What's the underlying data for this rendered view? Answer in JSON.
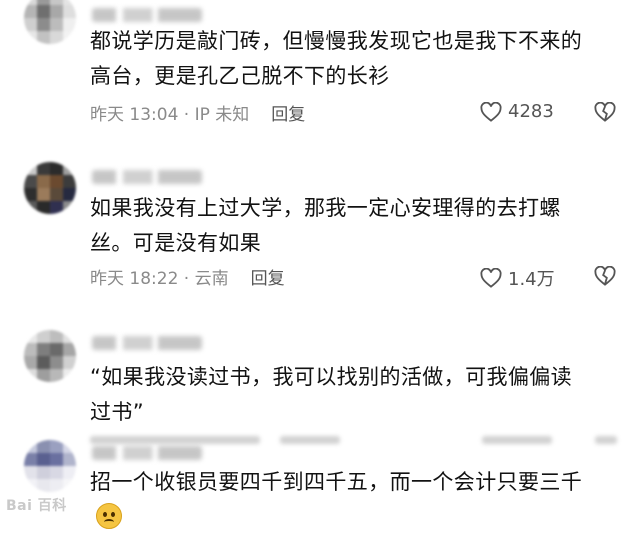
{
  "comments": [
    {
      "content": "都说学历是敲门砖，但慢慢我发现它也是我下不来的\n高台，更是孔乙己脱不下的长衫",
      "time": "昨天 13:04 · IP 未知",
      "reply_label": "回复",
      "likes": "4283"
    },
    {
      "content": "如果我没有上过大学，那我一定心安理得的去打螺\n丝。可是没有如果",
      "time": "昨天 18:22 · 云南",
      "reply_label": "回复",
      "likes": "1.4万"
    },
    {
      "content": "“如果我没读过书，我可以找别的活做，可我偏偏读\n过书”"
    },
    {
      "content": "招一个收银员要四千到四千五，而一个会计只要三千"
    }
  ],
  "watermark": "Bai 百科",
  "icons": {
    "like": "heart-outline-icon",
    "dislike": "broken-heart-icon",
    "emoji": "sad-face-emoji-icon"
  },
  "colors": {
    "text": "#121212",
    "meta": "#8a8a8a",
    "icon": "#555555"
  }
}
